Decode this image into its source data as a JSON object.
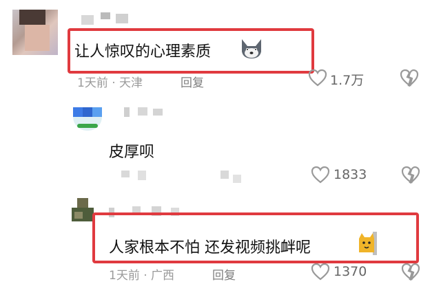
{
  "comments": [
    {
      "text": "让人惊叹的心理素质",
      "meta": "1天前 · 天津",
      "reply_label": "回复",
      "like_count": "1.7万",
      "emoji": "husky-emoji"
    },
    {
      "text": "皮厚呗",
      "meta": "",
      "reply_label": "",
      "like_count": "1833"
    },
    {
      "text": "人家根本不怕 还发视频挑衅呢",
      "meta": "1天前 · 广西",
      "reply_label": "回复",
      "like_count": "1370",
      "emoji": "cat-emoji"
    }
  ],
  "colors": {
    "highlight": "#e03a3f",
    "meta_text": "#9a9a9a",
    "icon": "#9a9a9a"
  }
}
